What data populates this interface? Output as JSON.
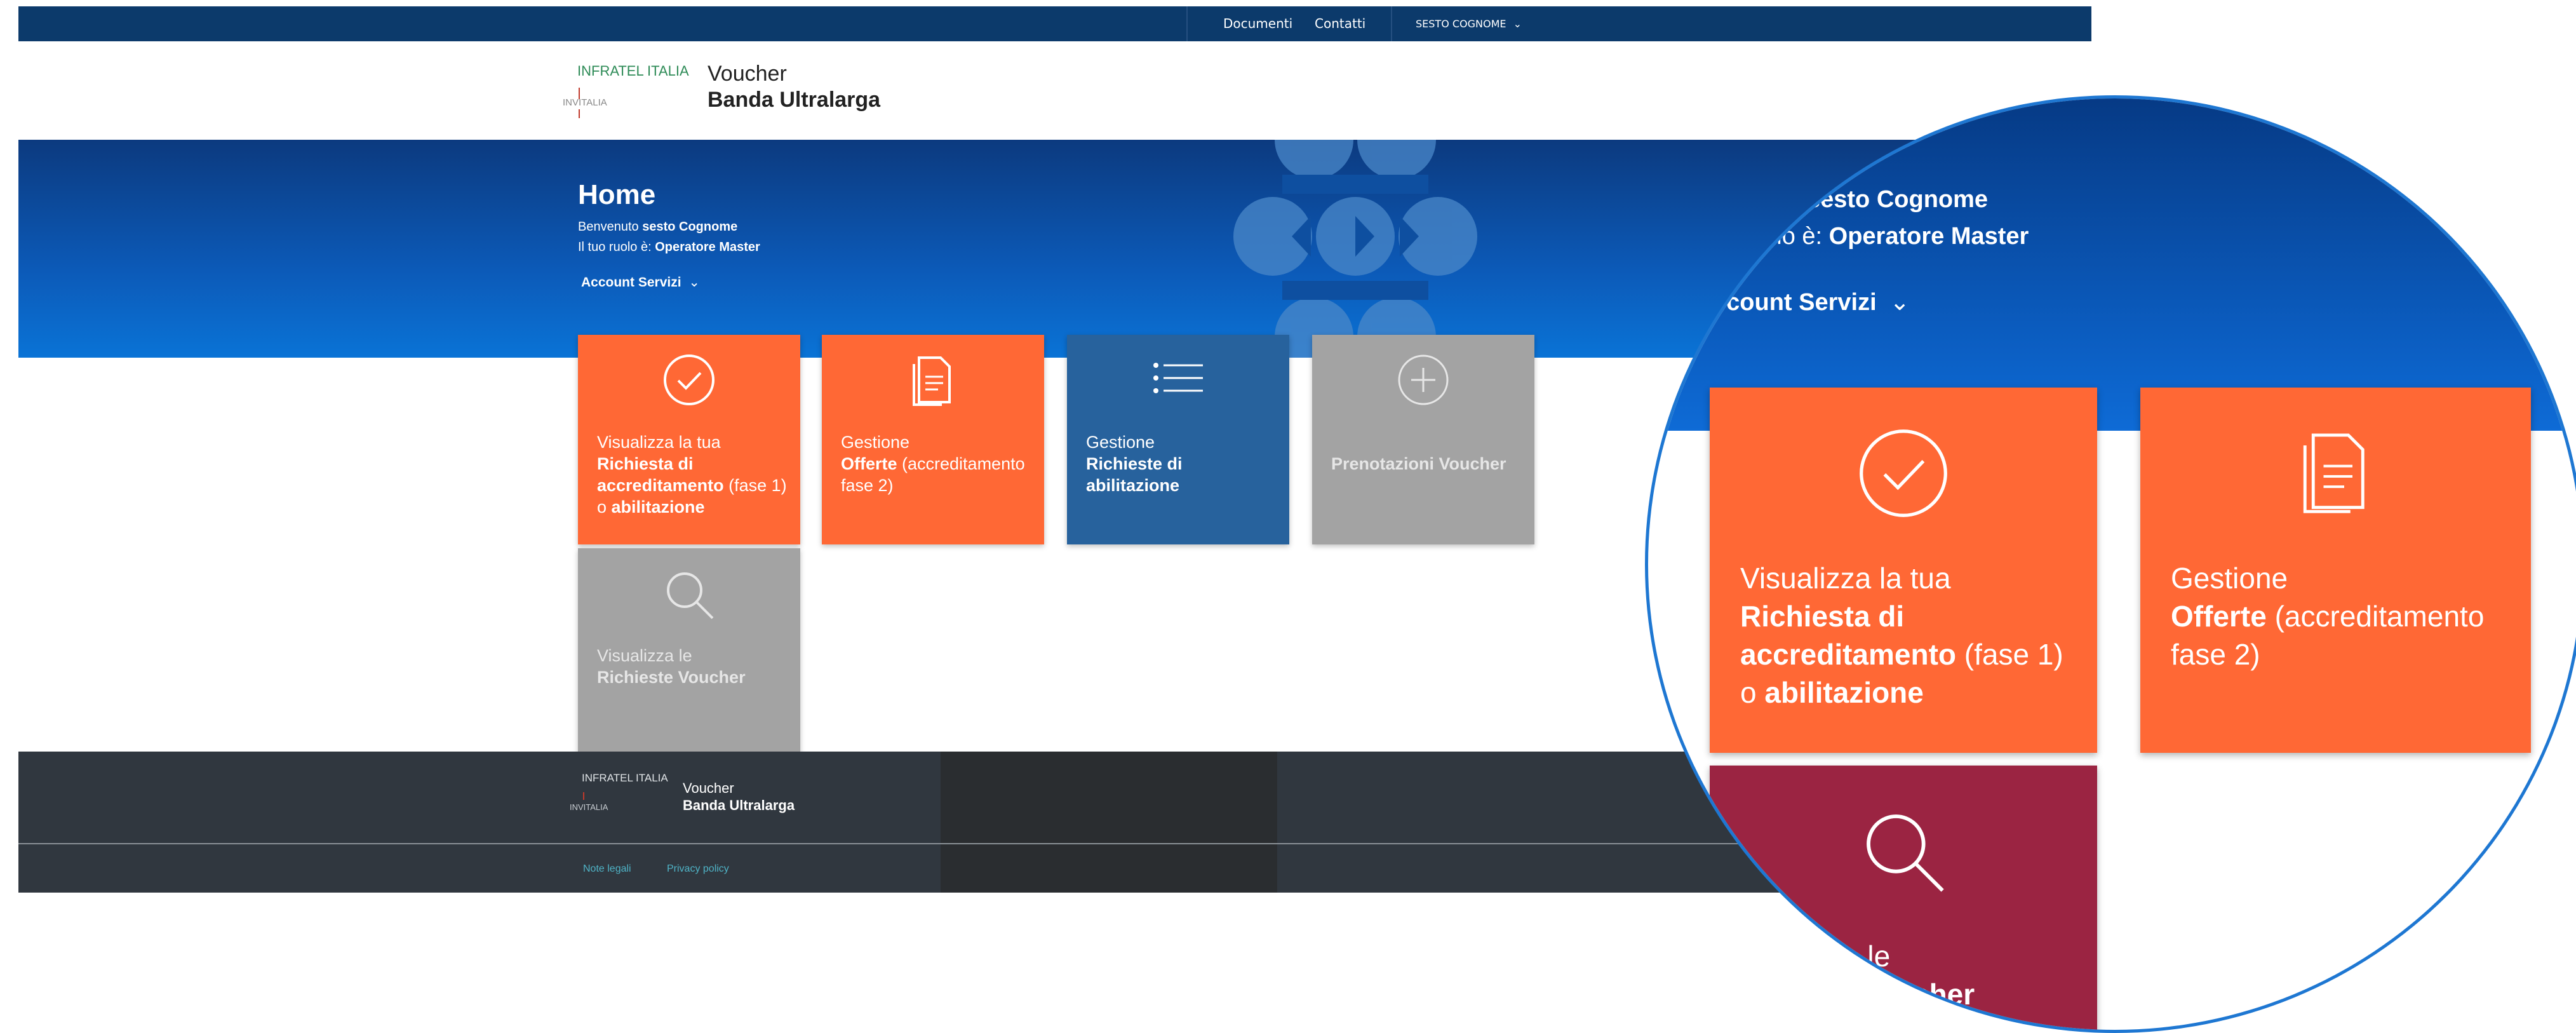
{
  "topbar": {
    "documenti": "Documenti",
    "contatti": "Contatti",
    "user_menu": "SESTO COGNOME"
  },
  "brand": {
    "logo_top": "INFRATEL ITALIA",
    "logo_bottom": "INVITALIA",
    "app_line1": "Voucher",
    "app_line2": "Banda Ultralarga"
  },
  "hero": {
    "title": "Home",
    "welcome_prefix": "Benvenuto",
    "welcome_name": "sesto Cognome",
    "role_prefix": "Il tuo ruolo è:",
    "role_value": "Operatore Master",
    "account_menu": "Account Servizi"
  },
  "tiles": [
    {
      "icon": "check-circle-icon",
      "color": "#ff6835",
      "line1": "Visualizza la tua",
      "bold1": "Richiesta di accreditamento",
      "rest1": " (fase 1) o ",
      "bold2": "abilitazione"
    },
    {
      "icon": "document-icon",
      "color": "#ff6835",
      "line1": "Gestione",
      "bold1": "Offerte",
      "rest1": " (accreditamento fase 2)"
    },
    {
      "icon": "list-icon",
      "color": "#27629d",
      "line1": "Gestione",
      "bold1": "Richieste di abilitazione"
    },
    {
      "icon": "plus-circle-icon",
      "color": "#a3a3a3",
      "bold1": "Prenotazioni Voucher"
    },
    {
      "icon": "search-icon",
      "color": "#a3a3a3",
      "line1": "Visualizza le",
      "bold1": "Richieste Voucher"
    }
  ],
  "footer": {
    "logo_top": "INFRATEL ITALIA",
    "logo_bottom": "INVITALIA",
    "app_line1": "Voucher",
    "app_line2": "Banda Ultralarga",
    "note_legali": "Note legali",
    "privacy": "Privacy policy"
  },
  "zoom": {
    "welcome_name": "sesto Cognome",
    "role_fragment": "uolo è:",
    "role_value": "Operatore Master",
    "account_menu": "ccount Servizi",
    "tile1": {
      "line1": "Visualizza la tua",
      "bold1": "Richiesta di",
      "bold2": "accreditamento",
      "rest1": " (fase 1)",
      "rest2": "o ",
      "bold3": "abilitazione"
    },
    "tile2": {
      "line1": "Gestione",
      "bold1": "Offerte",
      "rest1": " (accreditamento",
      "rest2": "fase 2)"
    },
    "tile3": {
      "line1": "a le",
      "bold1": "cher"
    }
  },
  "colors": {
    "topbar": "#0c3a6b",
    "orange": "#ff6835",
    "blue_tile": "#27629d",
    "grey_tile": "#a3a3a3",
    "maroon": "#9b2442",
    "footer": "#30373f",
    "link": "#4fb3c6"
  }
}
